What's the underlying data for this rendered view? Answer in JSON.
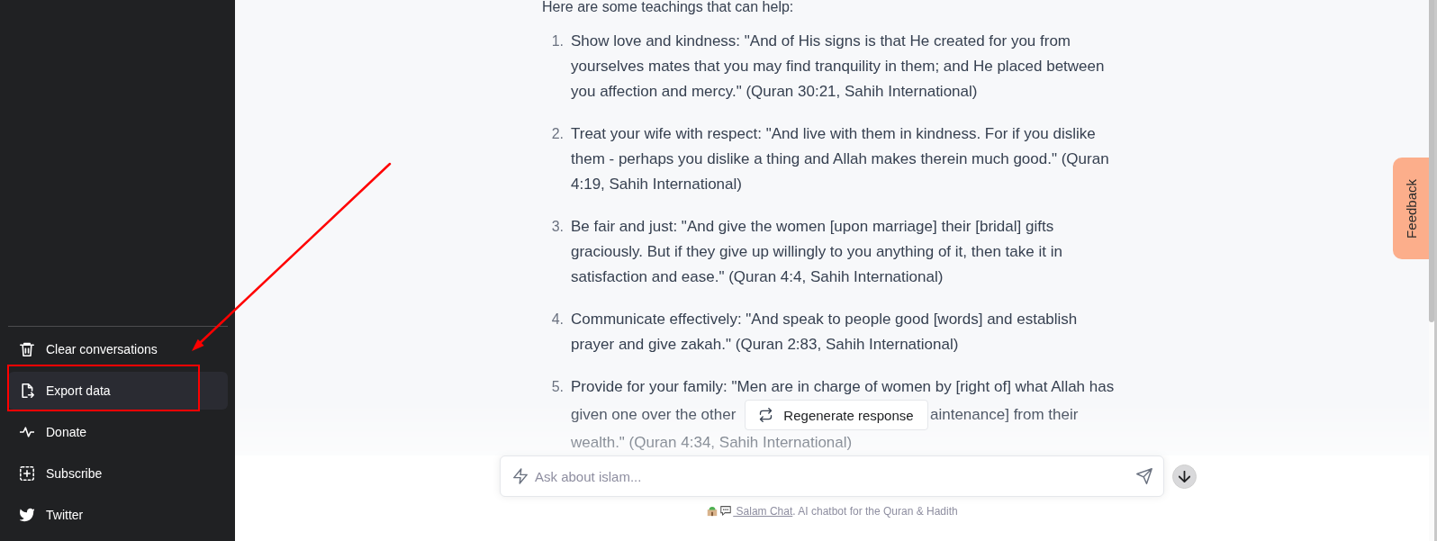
{
  "sidebar": {
    "items": [
      {
        "label": "Clear conversations",
        "selected": false,
        "annotated": false
      },
      {
        "label": "Export data",
        "selected": true,
        "annotated": true
      },
      {
        "label": "Donate",
        "selected": false,
        "annotated": false
      },
      {
        "label": "Subscribe",
        "selected": false,
        "annotated": false
      },
      {
        "label": "Twitter",
        "selected": false,
        "annotated": false
      }
    ]
  },
  "chat": {
    "intro": "Here are some teachings that can help:",
    "items": [
      {
        "number": "1.",
        "text": "Show love and kindness: \"And of His signs is that He created for you from yourselves mates that you may find tranquility in them; and He placed between you affection and mercy.\" (Quran 30:21, Sahih International)"
      },
      {
        "number": "2.",
        "text": "Treat your wife with respect: \"And live with them in kindness. For if you dislike them - perhaps you dislike a thing and Allah makes therein much good.\" (Quran 4:19, Sahih International)"
      },
      {
        "number": "3.",
        "text": "Be fair and just: \"And give the women [upon marriage] their [bridal] gifts graciously. But if they give up willingly to you anything of it, then take it in satisfaction and ease.\" (Quran 4:4, Sahih International)"
      },
      {
        "number": "4.",
        "text": "Communicate effectively: \"And speak to people good [words] and establish prayer and give zakah.\" (Quran 2:83, Sahih International)"
      },
      {
        "number": "5.",
        "text": "Provide for your family: \"Men are in charge of women by [right of] what Allah has",
        "segments": [
          "given one over the other",
          "aintenance] from their"
        ],
        "last_line": "wealth.\" (Quran 4:34, Sahih International)"
      }
    ]
  },
  "regenerate_button": "Regenerate response",
  "input": {
    "placeholder": "Ask about islam..."
  },
  "footer": {
    "link": "Salam Chat",
    "text": ". AI chatbot for the Quran & Hadith"
  },
  "feedback_tab": "Feedback"
}
